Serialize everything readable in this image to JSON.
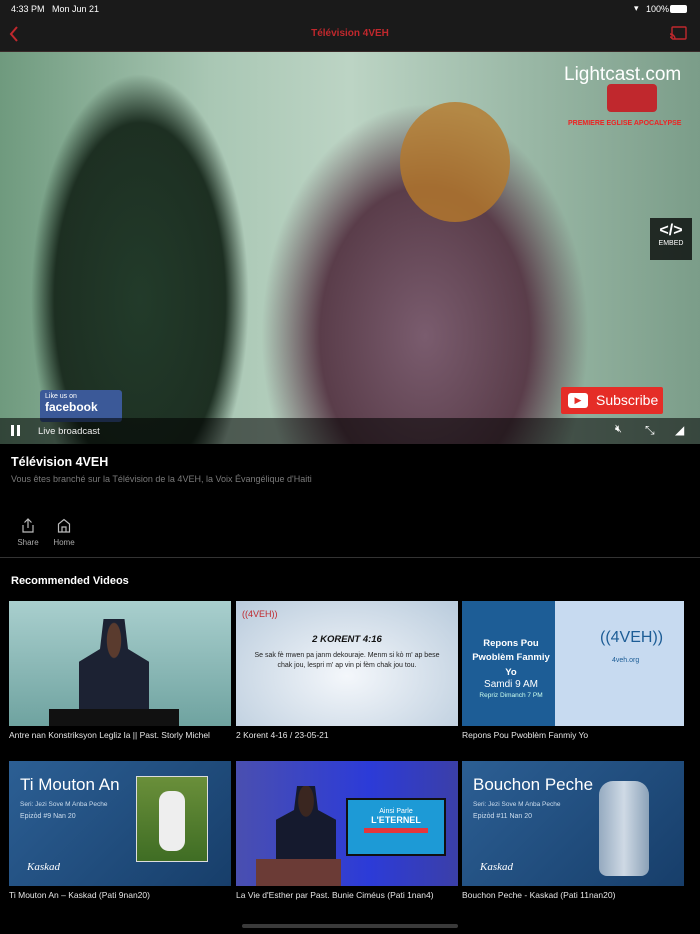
{
  "status_bar": {
    "time": "4:33 PM",
    "date": "Mon Jun 21",
    "battery": "100%"
  },
  "nav": {
    "title": "Télévision 4VEH",
    "back_icon": "chevron-left-icon",
    "cast_icon": "cast-icon"
  },
  "player": {
    "watermark": "Lightcast.com",
    "church": "PREMIERE EGLISE APOCALYPSE",
    "embed_label": "EMBED",
    "facebook_line1": "Like us on",
    "facebook_line2": "facebook",
    "subscribe_label": "Subscribe",
    "status": "Live broadcast"
  },
  "channel": {
    "title": "Télévision 4VEH",
    "description": "Vous êtes branché sur la Télévision de la 4VEH, la Voix Évangélique d'Haiti"
  },
  "actions": [
    {
      "label": "Share",
      "icon": "share-icon"
    },
    {
      "label": "Home",
      "icon": "home-icon"
    }
  ],
  "recommended": {
    "heading": "Recommended Videos",
    "videos": [
      {
        "title": "Antre nan Konstriksyon Legliz la || Past. Storly Michel"
      },
      {
        "title": "2 Korent 4-16 / 23-05-21",
        "overlay_heading": "2 KORENT 4:16",
        "overlay_text": "Se sak fè mwen pa janm dekouraje. Menm si kò m' ap bese chak jou, lespri m' ap vin pi fèm chak jou tou."
      },
      {
        "title": "Repons Pou Pwoblèm Fanmiy Yo",
        "overlay_heading": "Repons Pou Pwoblèm Fanmiy Yo",
        "overlay_time": "Samdi 9 AM",
        "overlay_sub": "Repriz Dimanch 7 PM",
        "overlay_site": "4veh.org"
      },
      {
        "title": "Ti Mouton An – Kaskad (Pati 9nan20)",
        "overlay_heading": "Ti Mouton An",
        "overlay_series": "Seri: Jezi Sove M Anba Peche",
        "overlay_episode": "Epizòd #9 Nan 20",
        "overlay_brand": "Kaskad"
      },
      {
        "title": "La Vie d'Esther par Past. Bunie Ciméus (Pati 1nan4)",
        "overlay_screen1": "Ainsi Parle",
        "overlay_screen2": "L'ETERNEL"
      },
      {
        "title": "Bouchon Peche - Kaskad (Pati 11nan20)",
        "overlay_heading": "Bouchon Peche",
        "overlay_series": "Seri: Jezi Sove M Anba Peche",
        "overlay_episode": "Epizòd #11 Nan 20",
        "overlay_brand": "Kaskad"
      }
    ]
  },
  "colors": {
    "accent": "#c0282d",
    "nav_bg": "#1a1a1a",
    "bg": "#000000"
  }
}
